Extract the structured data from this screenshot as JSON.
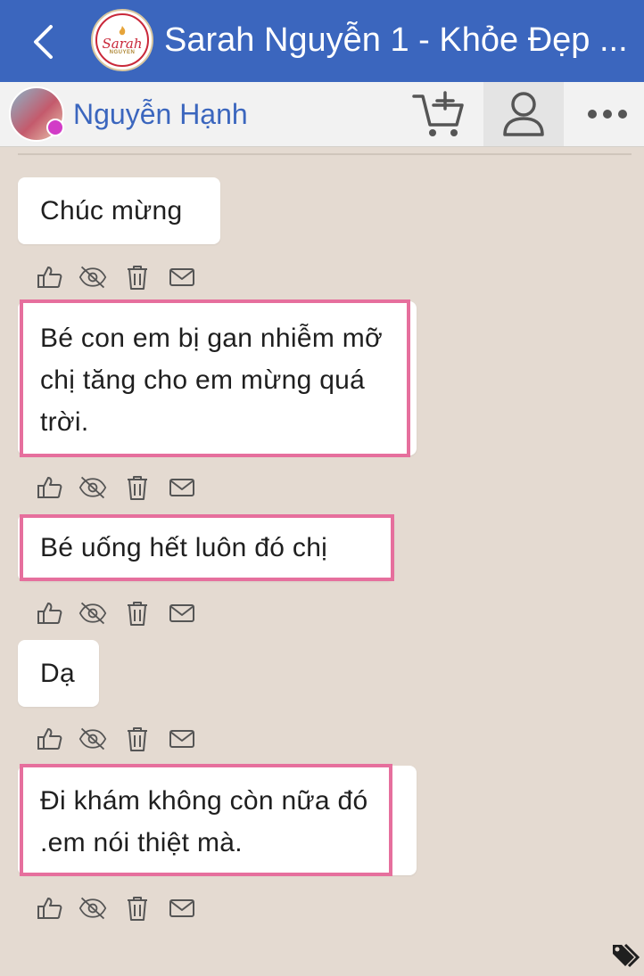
{
  "header": {
    "title": "Sarah Nguyễn 1 - Khỏe Đẹp ...",
    "logo": {
      "word": "Sarah",
      "sub": "NGUYEN"
    }
  },
  "contact": {
    "name": "Nguyễn Hạnh"
  },
  "messages": [
    {
      "text": "Chúc mừng",
      "highlighted": false
    },
    {
      "text": "Bé con em bị gan nhiễm mỡ chị tăng  cho em mừng quá trời.",
      "highlighted": true
    },
    {
      "text": "Bé uống hết luôn đó chị",
      "highlighted": true
    },
    {
      "text": "Dạ",
      "highlighted": false
    },
    {
      "text": "Đi khám không còn nữa đó .em nói thiệt mà.",
      "highlighted": true
    }
  ],
  "message_actions": [
    "like-icon",
    "hide-icon",
    "trash-icon",
    "mail-icon"
  ],
  "colors": {
    "header": "#3b66be",
    "background": "#e4dad1",
    "highlight": "#e66f9d",
    "icon": "#555555"
  }
}
